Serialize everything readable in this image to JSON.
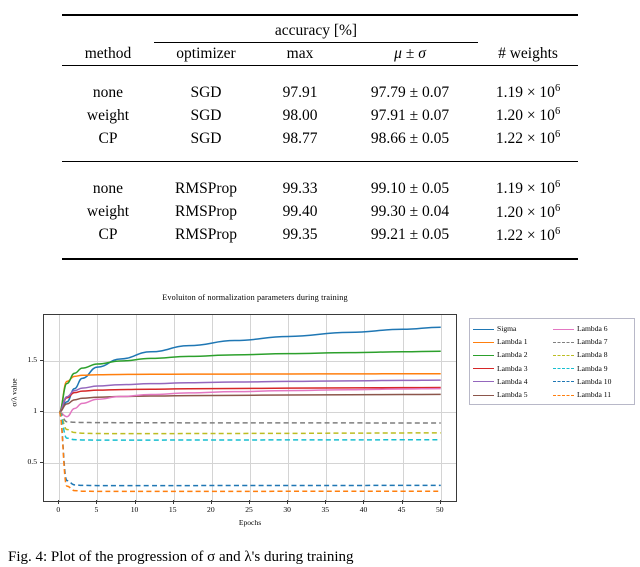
{
  "table": {
    "group_header": "accuracy  [%]",
    "columns": [
      "method",
      "optimizer",
      "max",
      "μ ± σ",
      "# weights"
    ],
    "groups": [
      {
        "rows": [
          {
            "method": "none",
            "optimizer": "SGD",
            "max": "97.91",
            "max_bold": false,
            "mu_sigma": "97.79 ± 0.07",
            "weights_mantissa": "1.19 × 10",
            "weights_exp": "6"
          },
          {
            "method": "weight",
            "optimizer": "SGD",
            "max": "98.00",
            "max_bold": false,
            "mu_sigma": "97.91 ± 0.07",
            "weights_mantissa": "1.20 × 10",
            "weights_exp": "6"
          },
          {
            "method": "CP",
            "optimizer": "SGD",
            "max": "98.77",
            "max_bold": true,
            "mu_sigma": "98.66 ± 0.05",
            "weights_mantissa": "1.22 × 10",
            "weights_exp": "6"
          }
        ]
      },
      {
        "rows": [
          {
            "method": "none",
            "optimizer": "RMSProp",
            "max": "99.33",
            "max_bold": false,
            "mu_sigma": "99.10 ± 0.05",
            "weights_mantissa": "1.19 × 10",
            "weights_exp": "6"
          },
          {
            "method": "weight",
            "optimizer": "RMSProp",
            "max": "99.40",
            "max_bold": true,
            "mu_sigma": "99.30 ± 0.04",
            "weights_mantissa": "1.20 × 10",
            "weights_exp": "6"
          },
          {
            "method": "CP",
            "optimizer": "RMSProp",
            "max": "99.35",
            "max_bold": false,
            "mu_sigma": "99.21 ± 0.05",
            "weights_mantissa": "1.22 × 10",
            "weights_exp": "6"
          }
        ]
      }
    ]
  },
  "caption": "Fig. 4: Plot of the progression of σ and λ's during training",
  "chart_data": {
    "type": "line",
    "title": "Evoluiton of normalization parameters during training",
    "xlabel": "Epochs",
    "ylabel": "σ/λ value",
    "xlim": [
      -2,
      52
    ],
    "ylim": [
      0.13,
      1.95
    ],
    "xticks": [
      0,
      5,
      10,
      15,
      20,
      25,
      30,
      35,
      40,
      45,
      50
    ],
    "yticks": [
      0.5,
      1,
      1.5
    ],
    "ytick_labels": [
      "0.5",
      "1",
      "1.5"
    ],
    "grid": true,
    "legend_position": "right-outside",
    "legend_columns": 2,
    "x": [
      0,
      1,
      2,
      3,
      5,
      8,
      12,
      17,
      23,
      30,
      38,
      45,
      50
    ],
    "series": [
      {
        "name": "Sigma",
        "color": "#1f77b4",
        "style": "solid",
        "values": [
          1.0,
          1.1,
          1.23,
          1.33,
          1.44,
          1.52,
          1.59,
          1.65,
          1.7,
          1.74,
          1.78,
          1.81,
          1.83
        ]
      },
      {
        "name": "Lambda 1",
        "color": "#ff7f0e",
        "style": "solid",
        "values": [
          1.0,
          1.3,
          1.35,
          1.36,
          1.365,
          1.368,
          1.37,
          1.371,
          1.372,
          1.373,
          1.374,
          1.375,
          1.375
        ]
      },
      {
        "name": "Lambda 2",
        "color": "#2ca02c",
        "style": "solid",
        "values": [
          1.0,
          1.28,
          1.38,
          1.43,
          1.47,
          1.5,
          1.525,
          1.545,
          1.56,
          1.572,
          1.582,
          1.59,
          1.595
        ]
      },
      {
        "name": "Lambda 3",
        "color": "#d62728",
        "style": "solid",
        "values": [
          1.0,
          1.14,
          1.19,
          1.205,
          1.215,
          1.22,
          1.224,
          1.228,
          1.231,
          1.234,
          1.237,
          1.239,
          1.24
        ]
      },
      {
        "name": "Lambda 4",
        "color": "#9467bd",
        "style": "solid",
        "values": [
          1.0,
          1.15,
          1.21,
          1.235,
          1.255,
          1.268,
          1.278,
          1.287,
          1.294,
          1.3,
          1.306,
          1.31,
          1.313
        ]
      },
      {
        "name": "Lambda 5",
        "color": "#8c564b",
        "style": "solid",
        "values": [
          1.0,
          1.08,
          1.12,
          1.135,
          1.145,
          1.152,
          1.157,
          1.161,
          1.164,
          1.167,
          1.17,
          1.172,
          1.173
        ]
      },
      {
        "name": "Lambda 6",
        "color": "#e377c2",
        "style": "solid",
        "values": [
          1.0,
          0.955,
          1.035,
          1.085,
          1.125,
          1.152,
          1.172,
          1.188,
          1.2,
          1.21,
          1.219,
          1.226,
          1.23
        ]
      },
      {
        "name": "Lambda 7",
        "color": "#7f7f7f",
        "style": "dashed",
        "values": [
          1.0,
          0.905,
          0.9,
          0.898,
          0.897,
          0.896,
          0.896,
          0.895,
          0.895,
          0.894,
          0.894,
          0.893,
          0.893
        ]
      },
      {
        "name": "Lambda 8",
        "color": "#bcbd22",
        "style": "dashed",
        "values": [
          1.0,
          0.83,
          0.8,
          0.793,
          0.79,
          0.789,
          0.789,
          0.79,
          0.791,
          0.792,
          0.794,
          0.796,
          0.797
        ]
      },
      {
        "name": "Lambda 9",
        "color": "#17becf",
        "style": "dashed",
        "values": [
          1.0,
          0.745,
          0.73,
          0.727,
          0.726,
          0.726,
          0.726,
          0.727,
          0.727,
          0.728,
          0.728,
          0.729,
          0.729
        ]
      },
      {
        "name": "Lambda 10",
        "color": "#1f77b4",
        "style": "dashed",
        "values": [
          1.0,
          0.33,
          0.288,
          0.283,
          0.281,
          0.281,
          0.281,
          0.281,
          0.282,
          0.282,
          0.282,
          0.283,
          0.283
        ]
      },
      {
        "name": "Lambda 11",
        "color": "#ff7f0e",
        "style": "dashed",
        "values": [
          1.0,
          0.275,
          0.232,
          0.226,
          0.224,
          0.224,
          0.224,
          0.224,
          0.224,
          0.225,
          0.225,
          0.225,
          0.225
        ]
      }
    ]
  }
}
